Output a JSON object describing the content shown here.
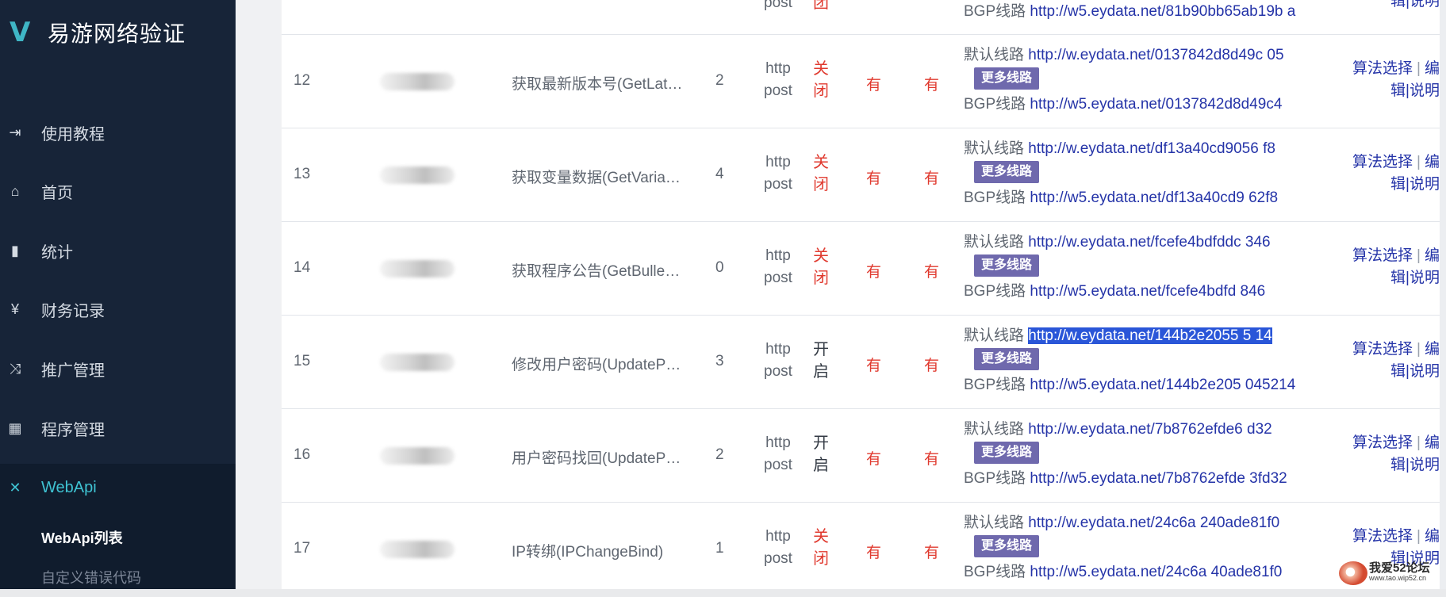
{
  "brand": {
    "title": "易游网络验证"
  },
  "nav": {
    "items": [
      {
        "label": "使用教程",
        "icon": "sign-in-icon"
      },
      {
        "label": "首页",
        "icon": "home-icon"
      },
      {
        "label": "统计",
        "icon": "bar-chart-icon"
      },
      {
        "label": "财务记录",
        "icon": "yen-icon"
      },
      {
        "label": "推广管理",
        "icon": "shuffle-icon"
      },
      {
        "label": "程序管理",
        "icon": "windows-icon"
      },
      {
        "label": "WebApi",
        "icon": "plug-icon"
      }
    ],
    "submenu": [
      {
        "label": "WebApi列表"
      },
      {
        "label": "自定义错误代码"
      }
    ]
  },
  "table": {
    "default_prefix": "默认线路",
    "bgp_prefix": "BGP线路",
    "more_label": "更多线路",
    "action_algo": "算法选择",
    "action_sep": "|",
    "action_edit_a": "编",
    "action_edit_b": "辑",
    "action_doc": "说明",
    "partial_row": {
      "method_post": "post",
      "status_char": "团",
      "bgp_url": "http://w5.eydata.net/81b90bb65ab19b a",
      "action": "辑|说明"
    },
    "rows": [
      {
        "id": "12",
        "name": "获取最新版本号(GetLat…",
        "count": "2",
        "method_a": "http",
        "method_b": "post",
        "status_a": "关",
        "status_b": "闭",
        "status_type": "closed",
        "has1": "有",
        "has2": "有",
        "default_url": "http://w.eydata.net/0137842d8d49c 05",
        "bgp_url": "http://w5.eydata.net/0137842d8d49c4",
        "highlight": false
      },
      {
        "id": "13",
        "name": "获取变量数据(GetVaria…",
        "count": "4",
        "method_a": "http",
        "method_b": "post",
        "status_a": "关",
        "status_b": "闭",
        "status_type": "closed",
        "has1": "有",
        "has2": "有",
        "default_url": "http://w.eydata.net/df13a40cd9056 f8",
        "bgp_url": "http://w5.eydata.net/df13a40cd9 62f8",
        "highlight": false
      },
      {
        "id": "14",
        "name": "获取程序公告(GetBulle…",
        "count": "0",
        "method_a": "http",
        "method_b": "post",
        "status_a": "关",
        "status_b": "闭",
        "status_type": "closed",
        "has1": "有",
        "has2": "有",
        "default_url": "http://w.eydata.net/fcefe4bdfddc 346",
        "bgp_url": "http://w5.eydata.net/fcefe4bdfd 846",
        "highlight": false
      },
      {
        "id": "15",
        "name": "修改用户密码(UpdateP…",
        "count": "3",
        "method_a": "http",
        "method_b": "post",
        "status_a": "开",
        "status_b": "启",
        "status_type": "open",
        "has1": "有",
        "has2": "有",
        "default_url": "http://w.eydata.net/144b2e2055 5 14",
        "bgp_url": "http://w5.eydata.net/144b2e205 045214",
        "highlight": true
      },
      {
        "id": "16",
        "name": "用户密码找回(UpdateP…",
        "count": "2",
        "method_a": "http",
        "method_b": "post",
        "status_a": "开",
        "status_b": "启",
        "status_type": "open",
        "has1": "有",
        "has2": "有",
        "default_url": "http://w.eydata.net/7b8762efde6 d32",
        "bgp_url": "http://w5.eydata.net/7b8762efde 3fd32",
        "highlight": false
      },
      {
        "id": "17",
        "name": "IP转绑(IPChangeBind)",
        "count": "1",
        "method_a": "http",
        "method_b": "post",
        "status_a": "关",
        "status_b": "闭",
        "status_type": "closed",
        "has1": "有",
        "has2": "有",
        "default_url": "http://w.eydata.net/24c6a 240ade81f0",
        "bgp_url": "http://w5.eydata.net/24c6a 40ade81f0",
        "highlight": false
      }
    ]
  },
  "watermark": {
    "line1": "我爱52论坛",
    "line2": "www.tao.wip52.cn"
  }
}
